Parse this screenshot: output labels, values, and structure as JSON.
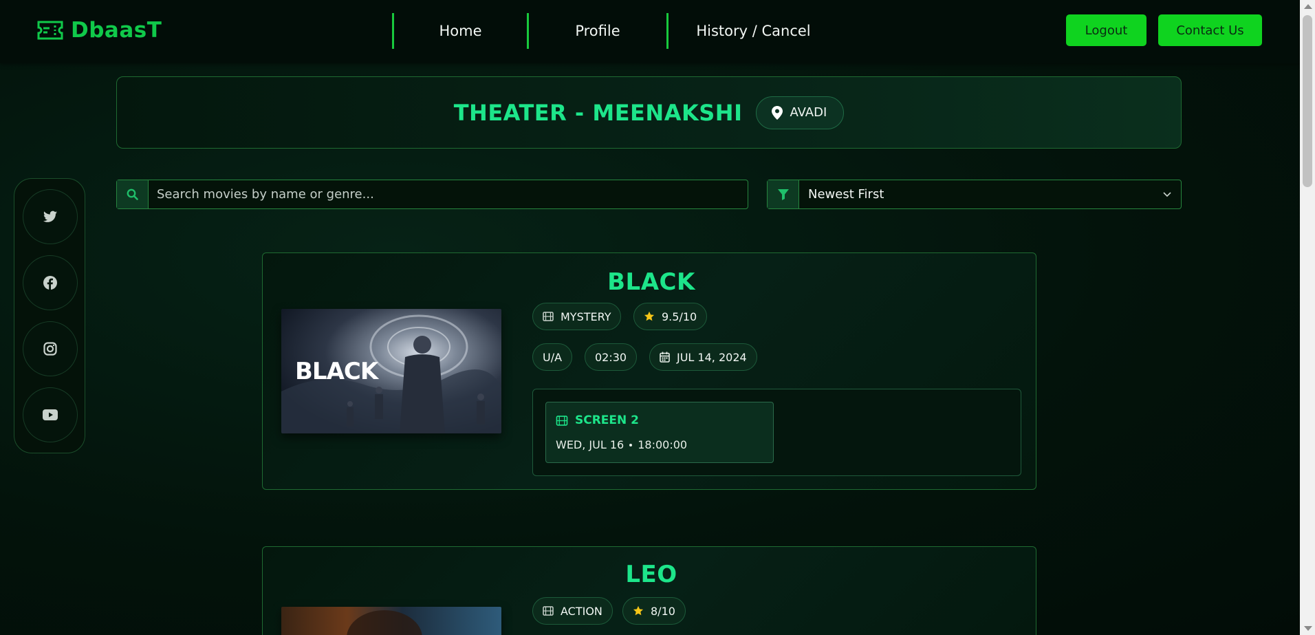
{
  "brand": {
    "name": "DbaasT"
  },
  "nav": {
    "home": "Home",
    "profile": "Profile",
    "history": "History / Cancel",
    "logout": "Logout",
    "contact": "Contact Us"
  },
  "theater": {
    "title": "THEATER - MEENAKSHI",
    "location": "AVADI"
  },
  "search": {
    "placeholder": "Search movies by name or genre..."
  },
  "sort": {
    "value": "Newest First"
  },
  "social": [
    "twitter-icon",
    "facebook-icon",
    "instagram-icon",
    "youtube-icon"
  ],
  "movies": [
    {
      "title": "BLACK",
      "poster_text": "BLACK",
      "genre": "MYSTERY",
      "rating": "9.5/10",
      "certificate": "U/A",
      "duration": "02:30",
      "release_date": "JUL 14, 2024",
      "shows": [
        {
          "screen": "SCREEN 2",
          "date": "WED, JUL 16",
          "time": "18:00:00"
        }
      ]
    },
    {
      "title": "LEO",
      "genre": "ACTION",
      "rating": "8/10"
    }
  ],
  "colors": {
    "accent": "#1de58a",
    "button": "#0fd31f",
    "background": "#031109",
    "star": "#f5c518"
  }
}
